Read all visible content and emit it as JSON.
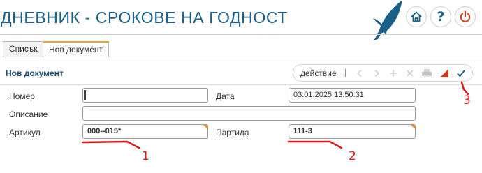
{
  "header": {
    "title": "ДНЕВНИК - СРОКОВЕ НА ГОДНОСТ",
    "icons": {
      "home": "home-icon",
      "help": "?",
      "power": "power-icon"
    },
    "colors": {
      "brand": "#1a5f86",
      "power": "#d33b1f",
      "accent": "#f0a030"
    }
  },
  "tabs": [
    {
      "label": "Списък",
      "active": false
    },
    {
      "label": "Нов документ",
      "active": true
    }
  ],
  "panel": {
    "title": "Нов документ",
    "action_label": "действие",
    "toolbar_icons": [
      "chevron-left-icon",
      "chevron-right-icon",
      "plus-icon",
      "x-icon",
      "print-icon",
      "flag-icon",
      "check-icon"
    ]
  },
  "form": {
    "number": {
      "label": "Номер",
      "value": ""
    },
    "date": {
      "label": "Дата",
      "value": "03.01.2025 13:50:31"
    },
    "description": {
      "label": "Описание",
      "value": ""
    },
    "article": {
      "label": "Артикул",
      "value": "000--015*"
    },
    "batch": {
      "label": "Партида",
      "value": "111-3"
    }
  },
  "annotations": [
    "1",
    "2",
    "3"
  ]
}
